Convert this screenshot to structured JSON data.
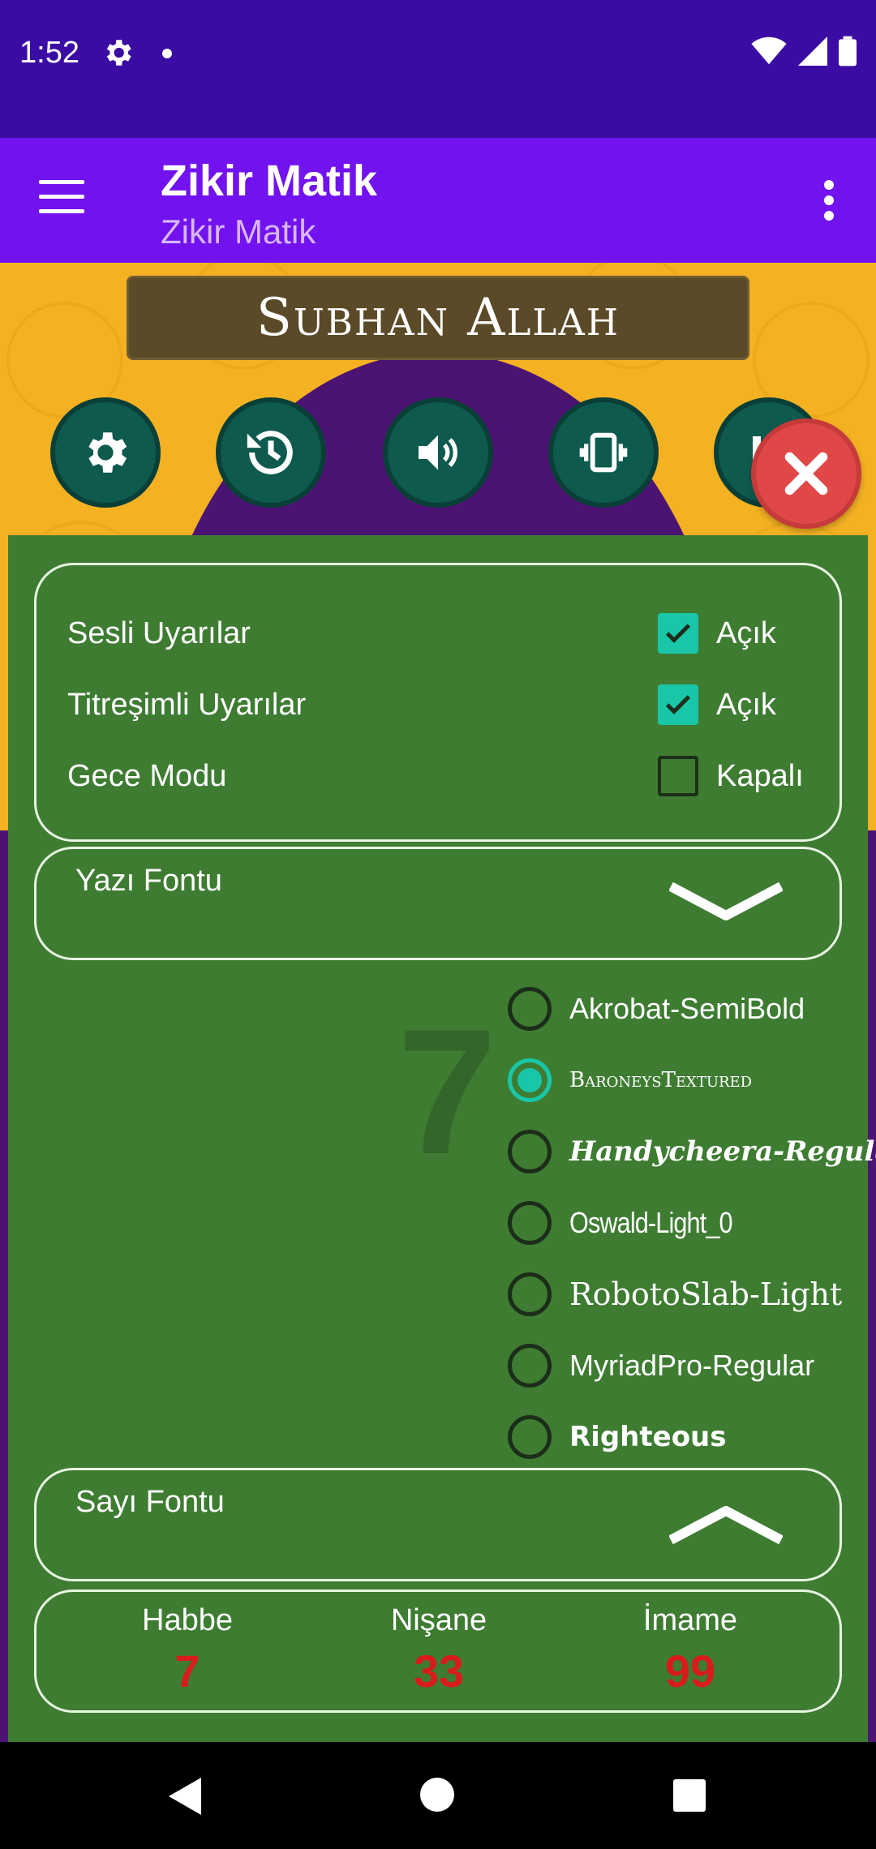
{
  "status_bar": {
    "time": "1:52"
  },
  "app_bar": {
    "title": "Zikir Matik",
    "subtitle": "Zikir Matik"
  },
  "banner": {
    "title": "Subhan Allah"
  },
  "settings": [
    {
      "label": "Sesli Uyarılar",
      "checked": true,
      "value": "Açık"
    },
    {
      "label": "Titreşimli Uyarılar",
      "checked": true,
      "value": "Açık"
    },
    {
      "label": "Gece Modu",
      "checked": false,
      "value": "Kapalı"
    }
  ],
  "text_font": {
    "label": "Yazı Fontu",
    "options": [
      {
        "label": "Akrobat-SemiBold",
        "selected": false
      },
      {
        "label": "BaroneysTextured",
        "selected": true
      },
      {
        "label": "Handycheera-Regular",
        "selected": false
      },
      {
        "label": "Oswald-Light_0",
        "selected": false
      },
      {
        "label": "RobotoSlab-Light",
        "selected": false
      },
      {
        "label": "MyriadPro-Regular",
        "selected": false
      },
      {
        "label": "Righteous",
        "selected": false
      }
    ]
  },
  "number_font": {
    "label": "Sayı Fontu"
  },
  "counts": [
    {
      "title": "Habbe",
      "value": "7"
    },
    {
      "title": "Nişane",
      "value": "33"
    },
    {
      "title": "İmame",
      "value": "99"
    }
  ],
  "colors": {
    "status": "#3A0CA3",
    "appbar": "#7212EE",
    "panel": "#3E7C32",
    "accent": "#19C6A8",
    "count": "#D81B1B"
  }
}
